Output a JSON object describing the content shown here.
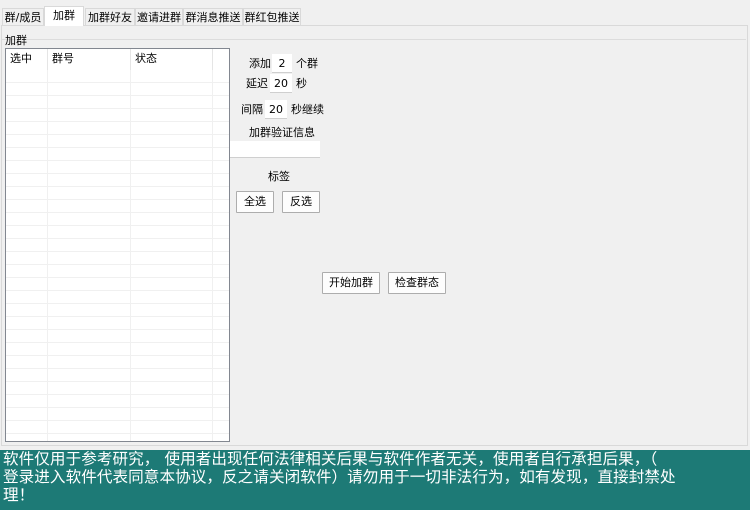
{
  "tabs": [
    {
      "label": "群/成员"
    },
    {
      "label": "加群"
    },
    {
      "label": "加群好友"
    },
    {
      "label": "邀请进群"
    },
    {
      "label": "群消息推送"
    },
    {
      "label": "群红包推送"
    }
  ],
  "group": {
    "title": "加群"
  },
  "list": {
    "columns": [
      "选中",
      "群号",
      "状态"
    ]
  },
  "form": {
    "add_prefix": "添加",
    "add_count": "2",
    "add_suffix": "个群",
    "delay_prefix": "延迟",
    "delay_value": "20",
    "delay_suffix": "秒",
    "interval_prefix": "间隔",
    "interval_value": "20",
    "interval_suffix": "秒继续",
    "verify_label": "加群验证信息",
    "verify_value": "",
    "tag_label": "标签"
  },
  "buttons": {
    "select_all": "全选",
    "invert": "反选",
    "start": "开始加群",
    "check": "检查群态"
  },
  "footer": {
    "line1": "软件仅用于参考研究，  使用者出现任何法律相关后果与软件作者无关，使用者自行承担后果，（",
    "line2": "登录进入软件代表同意本协议，反之请关闭软件）请勿用于一切非法行为，如有发现，直接封禁处",
    "line3": "理！"
  }
}
